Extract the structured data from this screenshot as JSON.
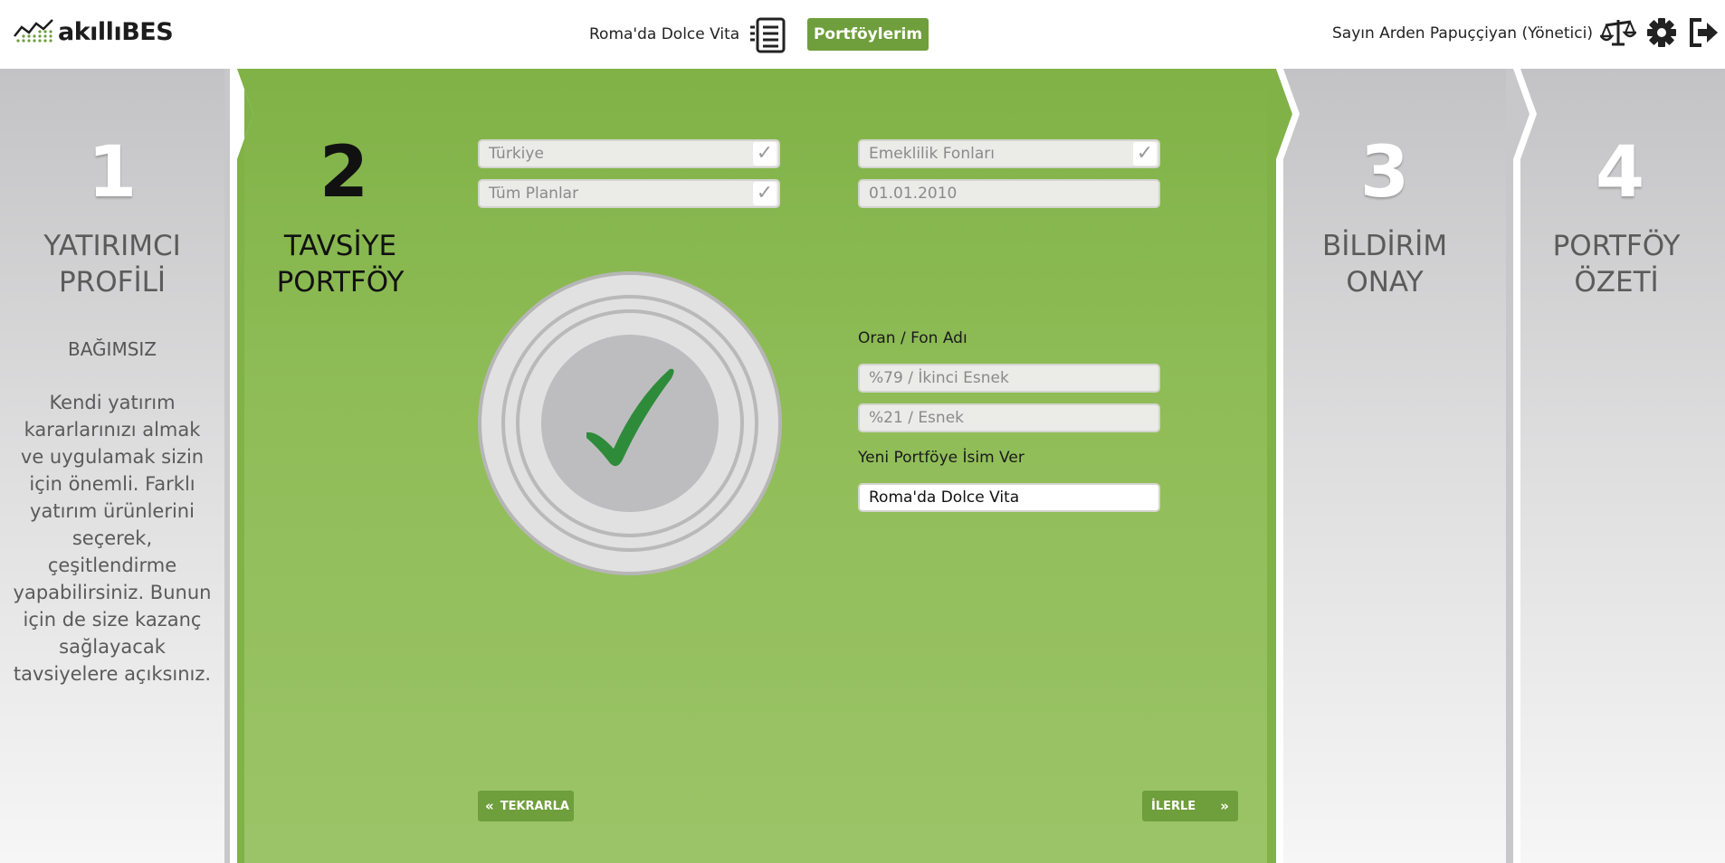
{
  "header": {
    "logo_text": "akıllıBES",
    "portfolio_name": "Roma'da Dolce Vita",
    "portfolios_button": "Portföylerim",
    "user_greeting": "Sayın Arden Papuççiyan (Yönetici)"
  },
  "steps": [
    {
      "number": "1",
      "title_line1": "YATIRIMCI",
      "title_line2": "PROFİLİ"
    },
    {
      "number": "2",
      "title_line1": "TAVSİYE",
      "title_line2": "PORTFÖY"
    },
    {
      "number": "3",
      "title_line1": "BİLDİRİM",
      "title_line2": "ONAY"
    },
    {
      "number": "4",
      "title_line1": "PORTFÖY",
      "title_line2": "ÖZETİ"
    }
  ],
  "profile": {
    "type": "BAĞIMSIZ",
    "description": "Kendi yatırım kararlarınızı almak ve uygulamak sizin için önemli. Farklı yatırım ürünlerini seçerek, çeşitlendirme yapabilirsiniz. Bunun için de size kazanç sağlayacak tavsiyelere açıksınız."
  },
  "form": {
    "country": "Türkiye",
    "fund_type": "Emeklilik Fonları",
    "plans": "Tüm Planlar",
    "date": "01.01.2010",
    "ratio_label": "Oran / Fon Adı",
    "fund1": "%79 / İkinci Esnek",
    "fund2": "%21 / Esnek",
    "name_label": "Yeni Portföye İsim Ver",
    "name_value": "Roma'da Dolce Vita"
  },
  "buttons": {
    "retry": "TEKRARLA",
    "next": "İLERLE"
  },
  "colors": {
    "accent": "#6f9e3c",
    "check_green": "#2e8b3a"
  }
}
